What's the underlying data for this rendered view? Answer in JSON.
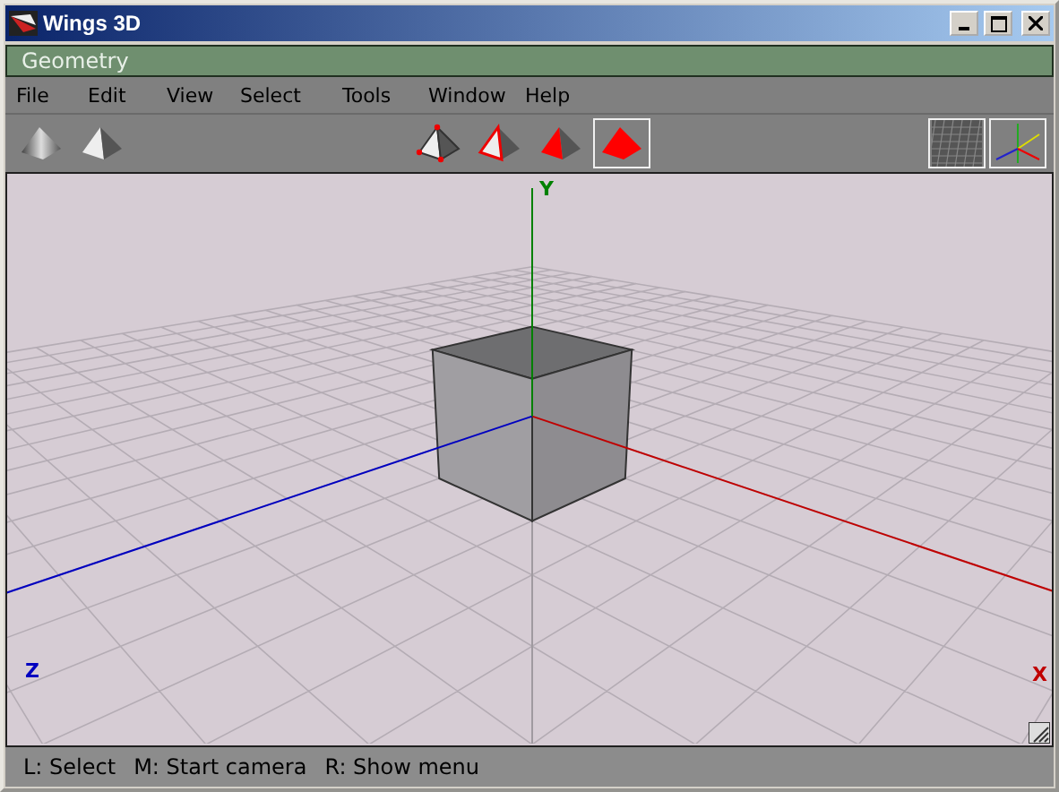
{
  "window": {
    "title": "Wings 3D"
  },
  "panel": {
    "title": "Geometry"
  },
  "menu": [
    "File",
    "Edit",
    "View",
    "Select",
    "Tools",
    "Window",
    "Help"
  ],
  "shading_buttons": [
    {
      "kind": "smooth"
    },
    {
      "kind": "flat"
    }
  ],
  "selection_modes": [
    {
      "kind": "vertex",
      "selected": false
    },
    {
      "kind": "edge",
      "selected": false
    },
    {
      "kind": "face",
      "selected": false
    },
    {
      "kind": "body",
      "selected": true
    }
  ],
  "view_toggles": [
    {
      "kind": "ground",
      "on": true
    },
    {
      "kind": "axes",
      "on": true
    }
  ],
  "viewport": {
    "axis_labels": [
      {
        "kind": "y",
        "label": "Y"
      },
      {
        "kind": "z",
        "label": "Z"
      },
      {
        "kind": "x",
        "label": "X"
      }
    ]
  },
  "status_bar": [
    "L: Select",
    "M: Start camera",
    "R: Show menu"
  ]
}
